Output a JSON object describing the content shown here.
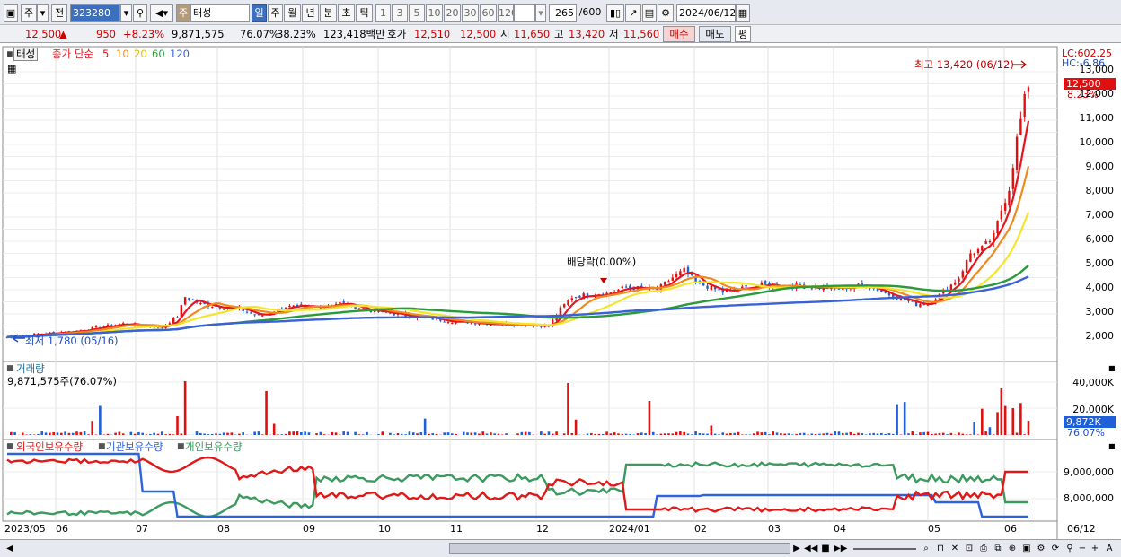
{
  "toolbar": {
    "code": "323280",
    "prev_label": "전",
    "week_label": "주",
    "stock_prefix": "주",
    "stock_name": "태성",
    "periods": [
      "일",
      "주",
      "월",
      "년",
      "분",
      "초",
      "틱"
    ],
    "minutes": [
      "1",
      "3",
      "5",
      "10",
      "20",
      "30",
      "60",
      "120"
    ],
    "count": "265",
    "count_max": "/600",
    "date": "2024/06/12"
  },
  "quote": {
    "price": "12,500",
    "arrow": "▲",
    "change": "950",
    "pct": "+8.23%",
    "volume": "9,871,575",
    "vol_ratio": "76.07%",
    "turnover": "38.23%",
    "amount": "123,418백만",
    "hoga_label": "호가",
    "hoga1": "12,510",
    "hoga2": "12,500",
    "open_label": "시",
    "open": "11,650",
    "high_label": "고",
    "high": "13,420",
    "low_label": "저",
    "low": "11,560",
    "buy": "매수",
    "sell": "매도",
    "avg": "평"
  },
  "price_panel": {
    "name": "태성",
    "legend_prefix": "종가 단순",
    "ma": [
      "5",
      "10",
      "20",
      "60",
      "120"
    ],
    "lc": "LC:602.25",
    "hc": "HC:-6.86",
    "cur_price": "12,500",
    "cur_pct": "8.23%",
    "high_note": "최고 13,420 (06/12)",
    "low_note": "최저 1,780 (05/16)",
    "div_note": "배당락(0.00%)",
    "yticks": [
      "13,000",
      "12,000",
      "11,000",
      "10,000",
      "9,000",
      "8,000",
      "7,000",
      "6,000",
      "5,000",
      "4,000",
      "3,000",
      "2,000"
    ]
  },
  "volume_panel": {
    "title": "거래량",
    "value": "9,871,575주(76.07%)",
    "yticks": [
      "40,000K",
      "20,000K"
    ],
    "cur": "9,872K",
    "cur_pct": "76.07%"
  },
  "holder_panel": {
    "foreign": "외국인보유수량",
    "inst": "기관보유수량",
    "indiv": "개인보유수량",
    "yticks": [
      "9,000,000",
      "8,000,000"
    ]
  },
  "xaxis": [
    "2023/05",
    "06",
    "07",
    "08",
    "09",
    "10",
    "11",
    "12",
    "2024/01",
    "02",
    "03",
    "04",
    "05",
    "06",
    "06/12"
  ],
  "colors": {
    "ma5": "#e8141c",
    "ma10": "#f08a1c",
    "ma20": "#f5e52a",
    "ma60": "#2a9a3a",
    "ma120": "#3a62d8",
    "up": "#e01010",
    "down": "#1f5fd8",
    "foreign": "#e01818",
    "inst": "#2f62e0",
    "indiv": "#3b9a5e"
  }
}
